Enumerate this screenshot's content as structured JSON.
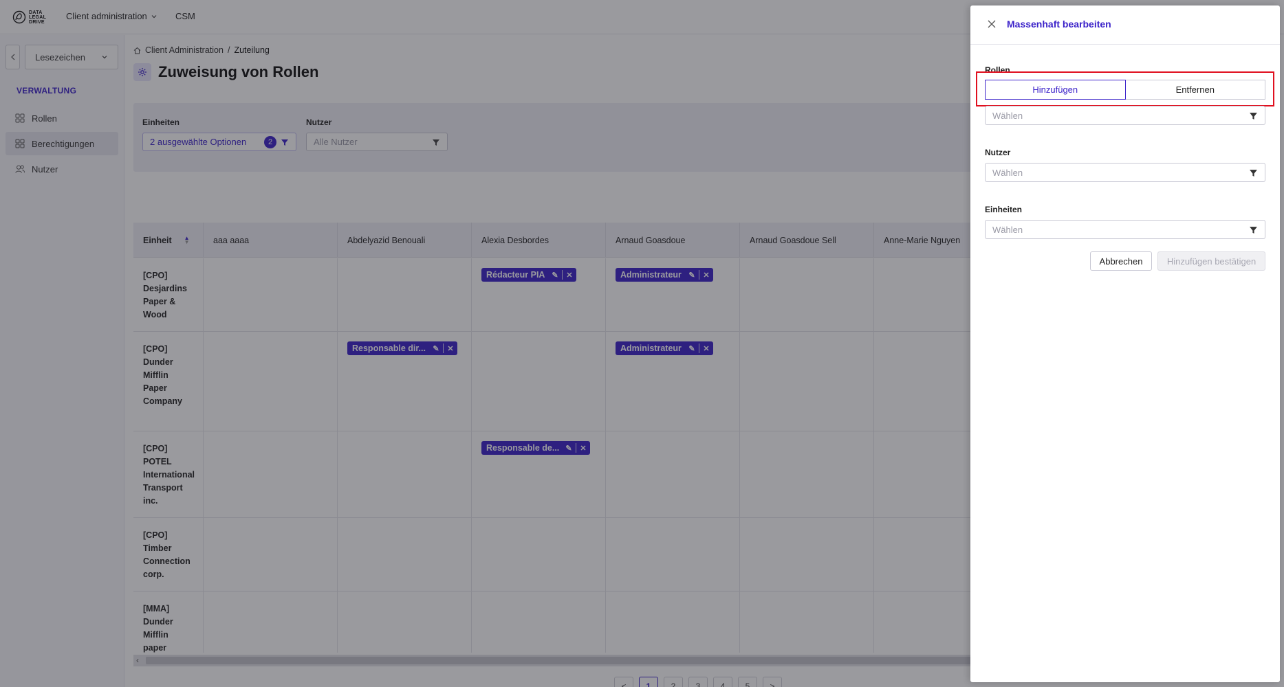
{
  "topbar": {
    "logo_text": [
      "DATA",
      "LEGAL",
      "DRIVE"
    ],
    "nav_client": "Client administration",
    "nav_csm": "CSM"
  },
  "sidebar": {
    "bookmark_label": "Lesezeichen",
    "section_title": "VERWALTUNG",
    "items": [
      {
        "label": "Rollen",
        "icon": "grid-icon"
      },
      {
        "label": "Berechtigungen",
        "icon": "grid-icon"
      },
      {
        "label": "Nutzer",
        "icon": "users-icon"
      }
    ]
  },
  "breadcrumb": {
    "root": "Client Administration",
    "separator": "/",
    "current": "Zuteilung"
  },
  "page": {
    "title": "Zuweisung von Rollen",
    "icon": "gear-icon"
  },
  "filters": {
    "units_label": "Einheiten",
    "units_value": "2 ausgewählte Optionen",
    "units_count": "2",
    "users_label": "Nutzer",
    "users_placeholder": "Alle Nutzer"
  },
  "table": {
    "headers": [
      "Einheit",
      "aaa aaaa",
      "Abdelyazid Benouali",
      "Alexia Desbordes",
      "Arnaud Goasdoue",
      "Arnaud Goasdoue Sell",
      "Anne-Marie Nguyen"
    ],
    "rows": [
      {
        "unit": "[CPO] Desjardins Paper & Wood",
        "tags": [
          {
            "col": 3,
            "label": "Rédacteur PIA"
          },
          {
            "col": 4,
            "label": "Administrateur"
          }
        ]
      },
      {
        "unit": "[CPO] Dunder Mifflin Paper Company",
        "tags": [
          {
            "col": 2,
            "label": "Responsable dir..."
          },
          {
            "col": 4,
            "label": "Administrateur"
          }
        ]
      },
      {
        "unit": "[CPO] POTEL International Transport inc.",
        "tags": [
          {
            "col": 3,
            "label": "Responsable de..."
          }
        ]
      },
      {
        "unit": "[CPO] Timber Connection corp.",
        "tags": []
      },
      {
        "unit": "[MMA] Dunder Mifflin paper company",
        "tags": []
      }
    ]
  },
  "pagination": {
    "prev": "<",
    "pages": [
      "1",
      "2",
      "3",
      "4",
      "5"
    ],
    "active": "1",
    "next": ">"
  },
  "drawer": {
    "title": "Massenhaft bearbeiten",
    "roles_label": "Rollen",
    "mode_add": "Hinzufügen",
    "mode_remove": "Entfernen",
    "selected_mode": "Hinzufügen",
    "roles_placeholder": "Wählen",
    "users_label": "Nutzer",
    "users_placeholder": "Wählen",
    "units_label": "Einheiten",
    "units_placeholder": "Wählen",
    "cancel_label": "Abbrechen",
    "confirm_label": "Hinzufügen bestätigen"
  },
  "colors": {
    "accent": "#3b22c9",
    "highlight": "#e0101f",
    "overlay": "rgba(30,30,40,0.45)"
  }
}
